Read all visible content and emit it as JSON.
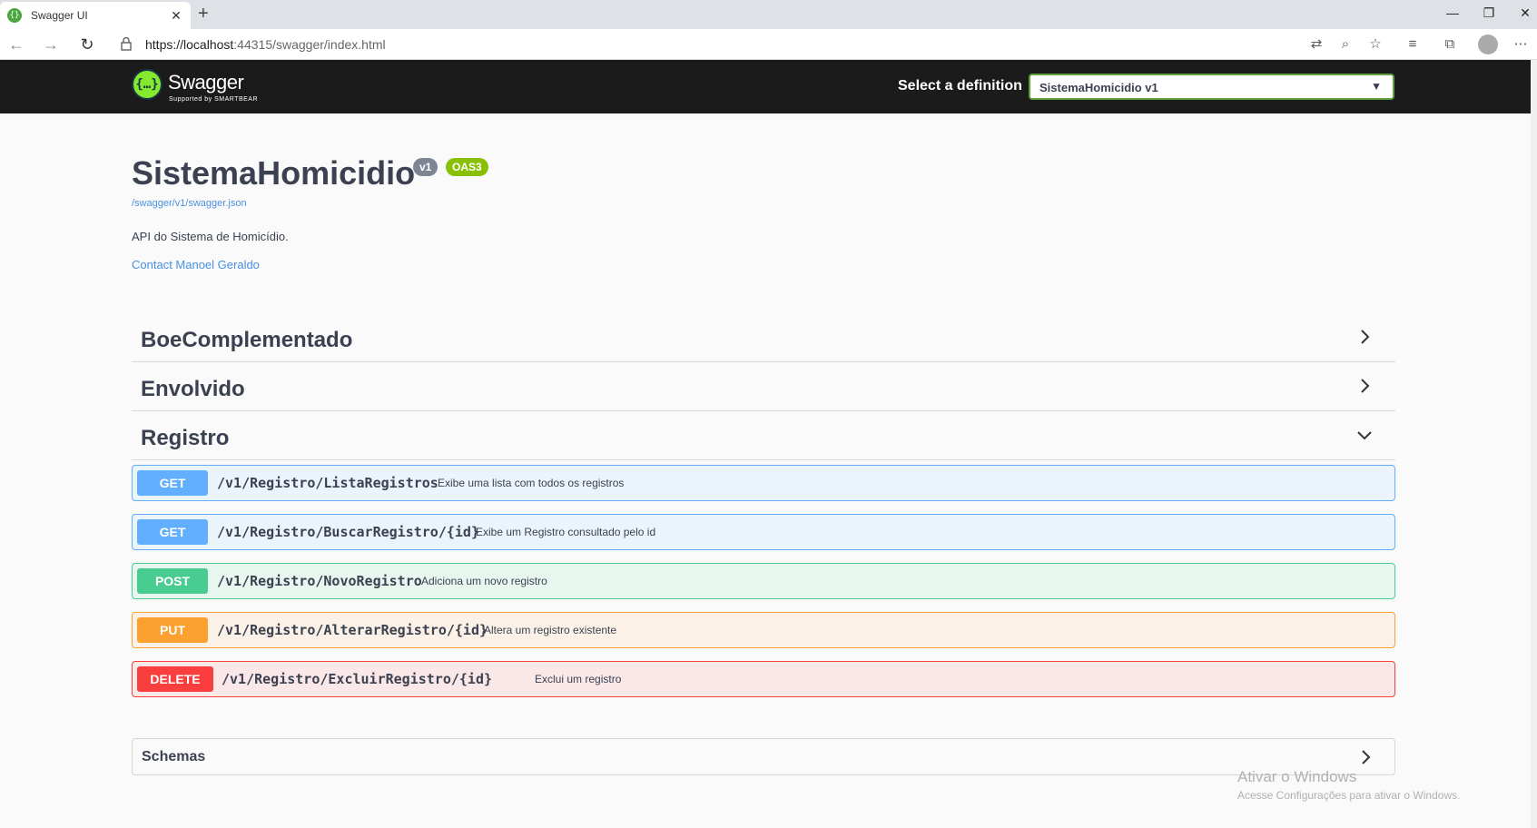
{
  "browser": {
    "tab_title": "Swagger UI",
    "tab_close": "✕",
    "new_tab": "+",
    "url_host": "https://localhost",
    "url_rest": ":44315/swagger/index.html",
    "win_min": "—",
    "win_max": "❐",
    "win_close": "✕"
  },
  "topbar": {
    "logo_text": "Swagger",
    "logo_sub": "Supported by SMARTBEAR",
    "select_label": "Select a definition",
    "select_value": "SistemaHomicidio v1"
  },
  "info": {
    "title": "SistemaHomicidio",
    "version_badge": "v1",
    "oas_badge": "OAS3",
    "json_link": "/swagger/v1/swagger.json",
    "description": "API do Sistema de Homicídio.",
    "contact": "Contact Manoel Geraldo"
  },
  "tags": [
    {
      "name": "BoeComplementado",
      "expanded": false
    },
    {
      "name": "Envolvido",
      "expanded": false
    },
    {
      "name": "Registro",
      "expanded": true
    }
  ],
  "operations": [
    {
      "method": "GET",
      "path": "/v1/Registro/ListaRegistros",
      "summary": "Exibe uma lista com todos os registros"
    },
    {
      "method": "GET",
      "path": "/v1/Registro/BuscarRegistro/{id}",
      "summary": "Exibe um Registro consultado pelo id"
    },
    {
      "method": "POST",
      "path": "/v1/Registro/NovoRegistro",
      "summary": "Adiciona um novo registro"
    },
    {
      "method": "PUT",
      "path": "/v1/Registro/AlterarRegistro/{id}",
      "summary": "Altera um registro existente"
    },
    {
      "method": "DELETE",
      "path": "/v1/Registro/ExcluirRegistro/{id}",
      "summary": "Exclui um registro"
    }
  ],
  "schemas": {
    "label": "Schemas"
  },
  "watermark": {
    "line1": "Ativar o Windows",
    "line2": "Acesse Configurações para ativar o Windows."
  }
}
